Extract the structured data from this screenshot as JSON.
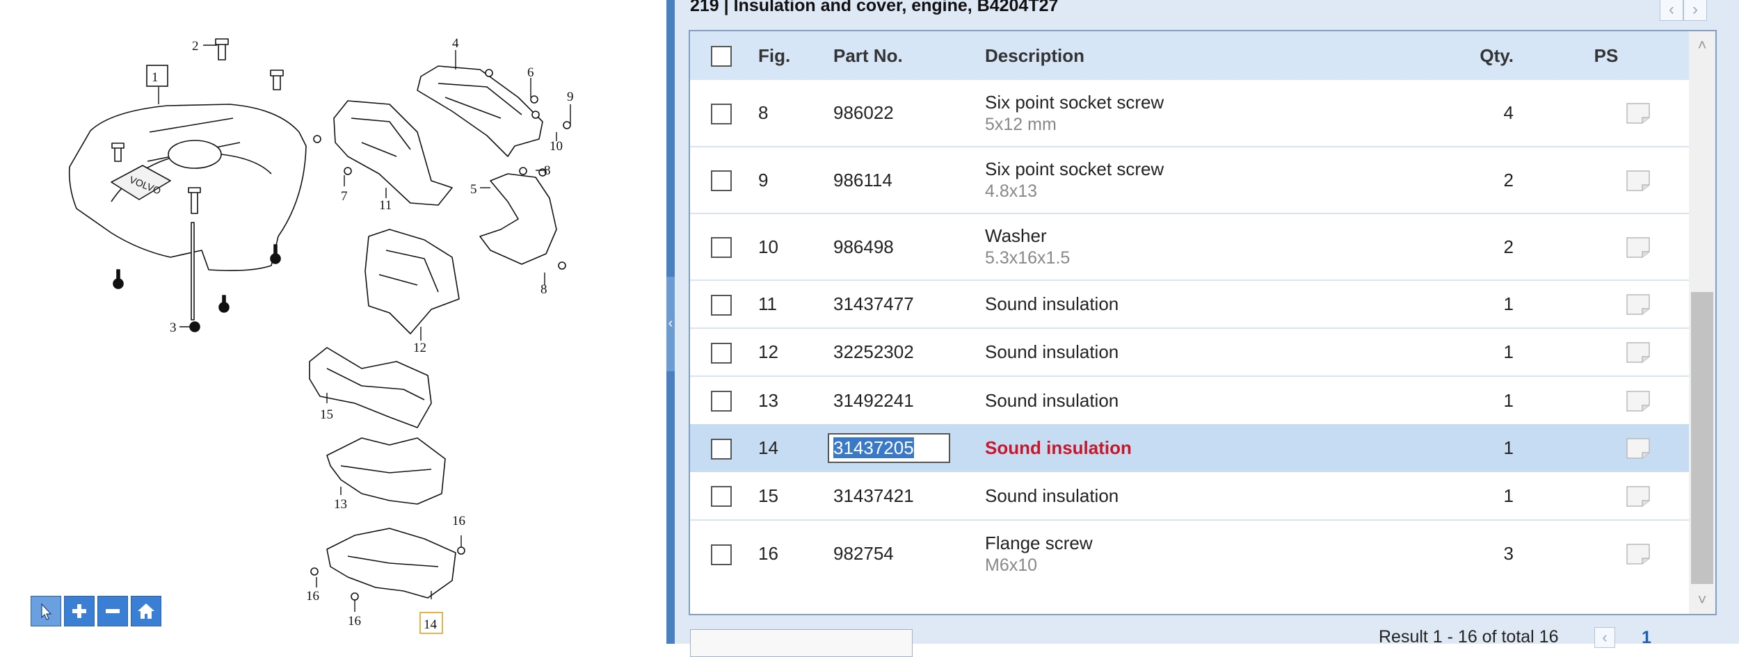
{
  "diagram": {
    "callouts": [
      "1",
      "2",
      "3",
      "4",
      "5",
      "6",
      "7",
      "8",
      "8",
      "9",
      "10",
      "11",
      "12",
      "13",
      "14",
      "15",
      "16",
      "16",
      "16"
    ],
    "boxed_callouts": [
      "1",
      "14"
    ],
    "toolbar": [
      {
        "name": "pointer",
        "icon": "cursor-icon",
        "active": true
      },
      {
        "name": "zoom-in",
        "icon": "plus-icon",
        "active": false
      },
      {
        "name": "zoom-out",
        "icon": "minus-icon",
        "active": false
      },
      {
        "name": "home",
        "icon": "home-icon",
        "active": false
      }
    ]
  },
  "panel": {
    "title": "219  |  Insulation and cover, engine, B4204T27",
    "nav_prev_icon": "chevron-left-icon",
    "nav_next_icon": "chevron-right-icon"
  },
  "table": {
    "headers": {
      "fig": "Fig.",
      "part": "Part No.",
      "desc": "Description",
      "qty": "Qty.",
      "ps": "PS"
    },
    "rows": [
      {
        "fig": "8",
        "part": "986022",
        "desc": "Six point socket screw",
        "sub": "5x12 mm",
        "qty": "4"
      },
      {
        "fig": "9",
        "part": "986114",
        "desc": "Six point socket screw",
        "sub": "4.8x13",
        "qty": "2"
      },
      {
        "fig": "10",
        "part": "986498",
        "desc": "Washer",
        "sub": "5.3x16x1.5",
        "qty": "2"
      },
      {
        "fig": "11",
        "part": "31437477",
        "desc": "Sound insulation",
        "sub": "",
        "qty": "1"
      },
      {
        "fig": "12",
        "part": "32252302",
        "desc": "Sound insulation",
        "sub": "",
        "qty": "1"
      },
      {
        "fig": "13",
        "part": "31492241",
        "desc": "Sound insulation",
        "sub": "",
        "qty": "1"
      },
      {
        "fig": "14",
        "part": "31437205",
        "desc": "Sound insulation",
        "sub": "",
        "qty": "1",
        "selected": true
      },
      {
        "fig": "15",
        "part": "31437421",
        "desc": "Sound insulation",
        "sub": "",
        "qty": "1"
      },
      {
        "fig": "16",
        "part": "982754",
        "desc": "Flange screw",
        "sub": "M6x10",
        "qty": "3"
      }
    ],
    "ps_icon": "note-icon"
  },
  "footer": {
    "result_text": "Result 1 - 16 of total 16",
    "current_page": "1"
  },
  "colors": {
    "accent": "#3b7fd4",
    "selected_row": "#c6dcf2",
    "selected_desc": "#c8162a",
    "header_bg": "#d7e6f6"
  }
}
